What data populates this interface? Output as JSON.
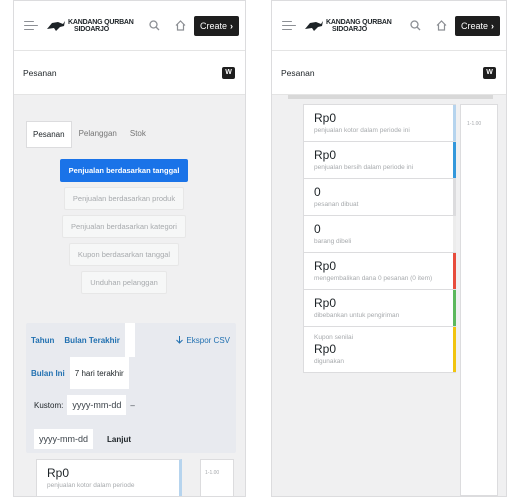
{
  "app": {
    "brand_line1": "KANDANG QURBAN",
    "brand_line2": "SIDOARJO",
    "create_label": "Create",
    "create_arrow": "›",
    "page_title": "Pesanan",
    "woo_badge": "W"
  },
  "left": {
    "tabs": [
      "Pesanan",
      "Pelanggan",
      "Stok"
    ],
    "reports": [
      "Penjualan berdasarkan tanggal",
      "Penjualan berdasarkan produk",
      "Penjualan berdasarkan kategori",
      "Kupon berdasarkan tanggal",
      "Unduhan pelanggan"
    ],
    "filters": {
      "tahun": "Tahun",
      "bulan_terakhir": "Bulan Terakhir",
      "export": "Ekspor CSV",
      "bulan_ini": "Bulan Ini",
      "tujuh_hari": "7 hari terakhir",
      "kustom": "Kustom:",
      "date_from_placeholder": "yyyy-mm-dd",
      "dash": "–",
      "date_to_placeholder": "yyyy-mm-dd",
      "lanjut": "Lanjut"
    },
    "mini_card": {
      "value": "Rp0",
      "desc": "penjualan kotor dalam periode"
    },
    "mini_aside": "1-1.00"
  },
  "right": {
    "side_tick": "1-1.00",
    "cards": [
      {
        "value": "Rp0",
        "desc": "penjualan kotor dalam periode ini",
        "accent": "#b6d4ee"
      },
      {
        "value": "Rp0",
        "desc": "penjualan bersih dalam periode ini",
        "accent": "#3498db"
      },
      {
        "value": "0",
        "desc": "pesanan dibuat",
        "accent": "#dcdcde"
      },
      {
        "value": "0",
        "desc": "barang dibeli",
        "accent": "#ececec"
      },
      {
        "value": "Rp0",
        "desc": "mengembalikan dana 0 pesanan (0 item)",
        "accent": "#e74c3c"
      },
      {
        "value": "Rp0",
        "desc": "dibebankan untuk pengiriman",
        "accent": "#5cb85c"
      },
      {
        "pre": "Kupon senilai",
        "value": "Rp0",
        "desc": "digunakan",
        "accent": "#f1c40f"
      }
    ]
  },
  "colors": {
    "primary": "#1a73e8",
    "link": "#2271b1"
  }
}
